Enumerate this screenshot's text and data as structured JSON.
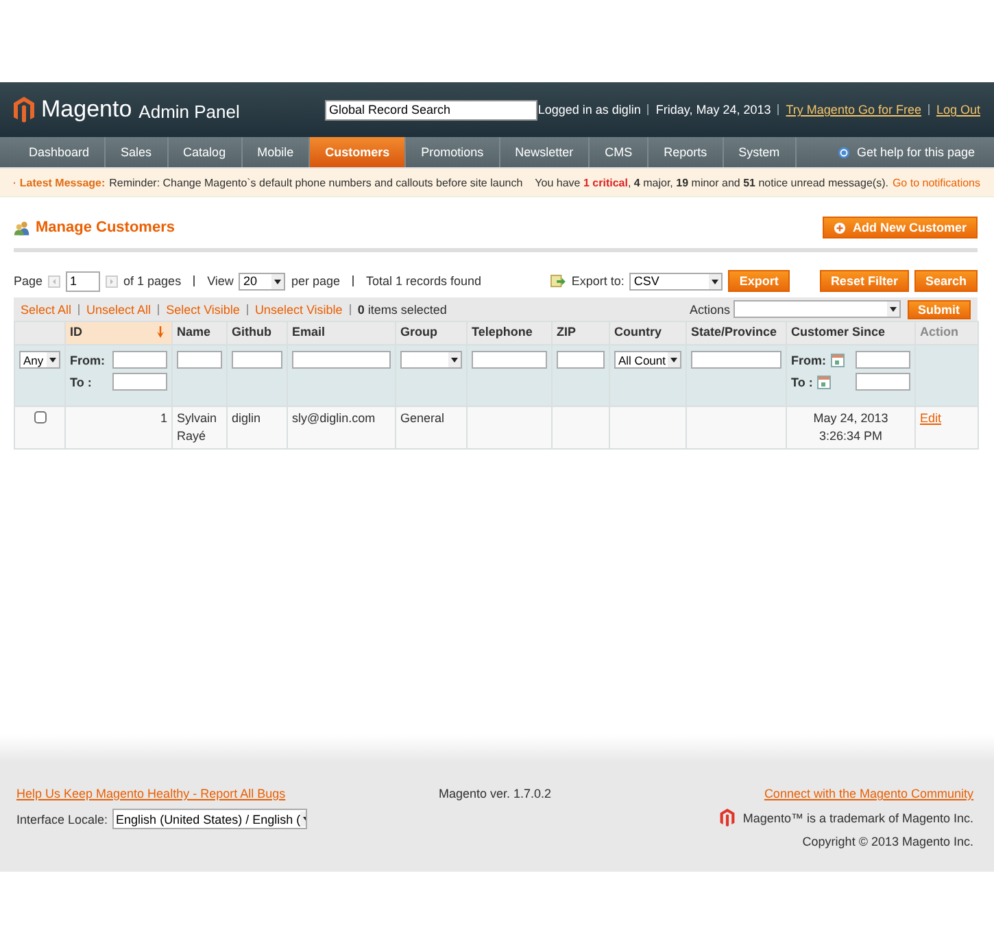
{
  "header": {
    "logo": "Magento",
    "logo_sub": "Admin Panel",
    "search_value": "Global Record Search",
    "user": "Logged in as diglin",
    "date": "Friday, May 24, 2013",
    "links": [
      "Try Magento Go for Free",
      "Log Out"
    ]
  },
  "nav": {
    "items": [
      {
        "label": "Dashboard",
        "selected": false
      },
      {
        "label": "Sales",
        "selected": false
      },
      {
        "label": "Catalog",
        "selected": false
      },
      {
        "label": "Mobile",
        "selected": false
      },
      {
        "label": "Customers",
        "selected": true
      },
      {
        "label": "Promotions",
        "selected": false
      },
      {
        "label": "Newsletter",
        "selected": false
      },
      {
        "label": "CMS",
        "selected": false
      },
      {
        "label": "Reports",
        "selected": false
      },
      {
        "label": "System",
        "selected": false
      }
    ],
    "help": "Get help for this page"
  },
  "message": {
    "label": "Latest Message:",
    "text": "Reminder: Change Magento`s default phone numbers and callouts before site launch",
    "summary": [
      {
        "text": "You have",
        "kind": "plain"
      },
      {
        "text": "1 critical",
        "kind": "critical"
      },
      {
        "text": ",",
        "kind": "plain"
      },
      {
        "text": "4",
        "kind": "bold"
      },
      {
        "text": "major,",
        "kind": "plain"
      },
      {
        "text": "19",
        "kind": "bold"
      },
      {
        "text": "minor and",
        "kind": "plain"
      },
      {
        "text": "51",
        "kind": "bold"
      },
      {
        "text": "notice unread message(s).",
        "kind": "plain"
      }
    ],
    "link": "Go to notifications"
  },
  "page": {
    "title": "Manage Customers",
    "add_button": "Add New Customer"
  },
  "pager": {
    "page_label": "Page",
    "page": "1",
    "of_pages": "of 1 pages",
    "view_label": "View",
    "view": "20",
    "per_page": "per page",
    "total": "Total 1 records found",
    "export_label": "Export to:",
    "export_format": "CSV",
    "export_button": "Export",
    "reset_button": "Reset Filter",
    "search_button": "Search"
  },
  "massaction": {
    "links": [
      "Select All",
      "Unselect All",
      "Select Visible",
      "Unselect Visible"
    ],
    "count": "0",
    "count_label": "items selected",
    "actions_label": "Actions",
    "submit": "Submit"
  },
  "columns": [
    {
      "sorted": false,
      "filter": {
        "kind": "select",
        "value": "Any"
      }
    },
    {
      "label": "ID",
      "sorted": true,
      "filter": {
        "kind": "range",
        "from": "From:",
        "to": "To :"
      }
    },
    {
      "label": "Name",
      "sorted": false,
      "filter": {
        "kind": "text"
      }
    },
    {
      "label": "Github",
      "sorted": false,
      "filter": {
        "kind": "text"
      }
    },
    {
      "label": "Email",
      "sorted": false,
      "filter": {
        "kind": "text"
      }
    },
    {
      "label": "Group",
      "sorted": false,
      "filter": {
        "kind": "select"
      }
    },
    {
      "label": "Telephone",
      "sorted": false,
      "filter": {
        "kind": "text"
      }
    },
    {
      "label": "ZIP",
      "sorted": false,
      "filter": {
        "kind": "text"
      }
    },
    {
      "label": "Country",
      "sorted": false,
      "filter": {
        "kind": "select",
        "value": "All Count"
      }
    },
    {
      "label": "State/Province",
      "sorted": false,
      "filter": {
        "kind": "text"
      }
    },
    {
      "label": "Customer Since",
      "sorted": false,
      "filter": {
        "kind": "daterange",
        "from": "From:",
        "to": "To :"
      }
    },
    {
      "label": "Action",
      "sorted": false,
      "filter": {
        "kind": "none"
      }
    }
  ],
  "rows": [
    {
      "checked": false,
      "cells": [
        "1",
        "Sylvain Rayé",
        "diglin",
        "sly@diglin.com",
        "General",
        "",
        "",
        "",
        "",
        "May 24, 2013 3:26:34 PM"
      ],
      "action": "Edit"
    }
  ],
  "footer": {
    "bugs_link": "Help Us Keep Magento Healthy - Report All Bugs",
    "locale_label": "Interface Locale:",
    "locale": "English (United States) / English (",
    "version": "Magento ver. 1.7.0.2",
    "community_link": "Connect with the Magento Community",
    "trademark": "Magento™ is a trademark of Magento Inc.",
    "copyright": "Copyright © 2013 Magento Inc."
  }
}
